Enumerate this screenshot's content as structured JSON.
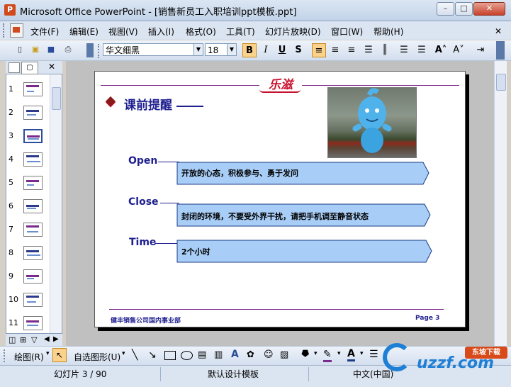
{
  "window": {
    "title": "Microsoft Office PowerPoint - [销售新员工入职培训ppt模板.ppt]",
    "app_icon": "powerpoint-icon",
    "buttons": [
      "minimize",
      "restore",
      "close"
    ]
  },
  "menu": {
    "items": [
      "文件(F)",
      "编辑(E)",
      "视图(V)",
      "插入(I)",
      "格式(O)",
      "工具(T)",
      "幻灯片放映(D)",
      "窗口(W)",
      "帮助(H)"
    ]
  },
  "toolbar": {
    "font_name": "华文细黑",
    "font_size": "18",
    "bold_label": "B",
    "italic_label": "I",
    "underline_label": "U",
    "shadow_label": "S",
    "bold_active": true
  },
  "slides_panel": {
    "numbers": [
      "1",
      "2",
      "3",
      "4",
      "5",
      "6",
      "7",
      "8",
      "9",
      "10",
      "11"
    ],
    "selected_index": 2
  },
  "slide": {
    "logo_text": "乐滋",
    "heading": "课前提醒",
    "items": [
      {
        "label": "Open",
        "text": "开放的心态，积极参与、勇于发问"
      },
      {
        "label": "Close",
        "text": "封闭的环境，不要受外界干扰，请把手机调至静音状态"
      },
      {
        "label": "Time",
        "text": "2个小时"
      }
    ],
    "footer_left": "健丰销售公司国内事业部",
    "footer_right": "Page 3"
  },
  "drawing_toolbar": {
    "draw_label": "绘图(R)",
    "autoshape_label": "自选图形(U)"
  },
  "statusbar": {
    "slide_info": "幻灯片 3 / 90",
    "template": "默认设计模板",
    "language": "中文(中国)"
  },
  "watermark": {
    "text": "uzzf.com",
    "badge": "东坡下载"
  },
  "colors": {
    "accent_red": "#c8102e",
    "slide_text_blue": "#1f1f8f",
    "arrow_fill": "#a8cdf6",
    "footer_purple": "#7a2a8a"
  }
}
